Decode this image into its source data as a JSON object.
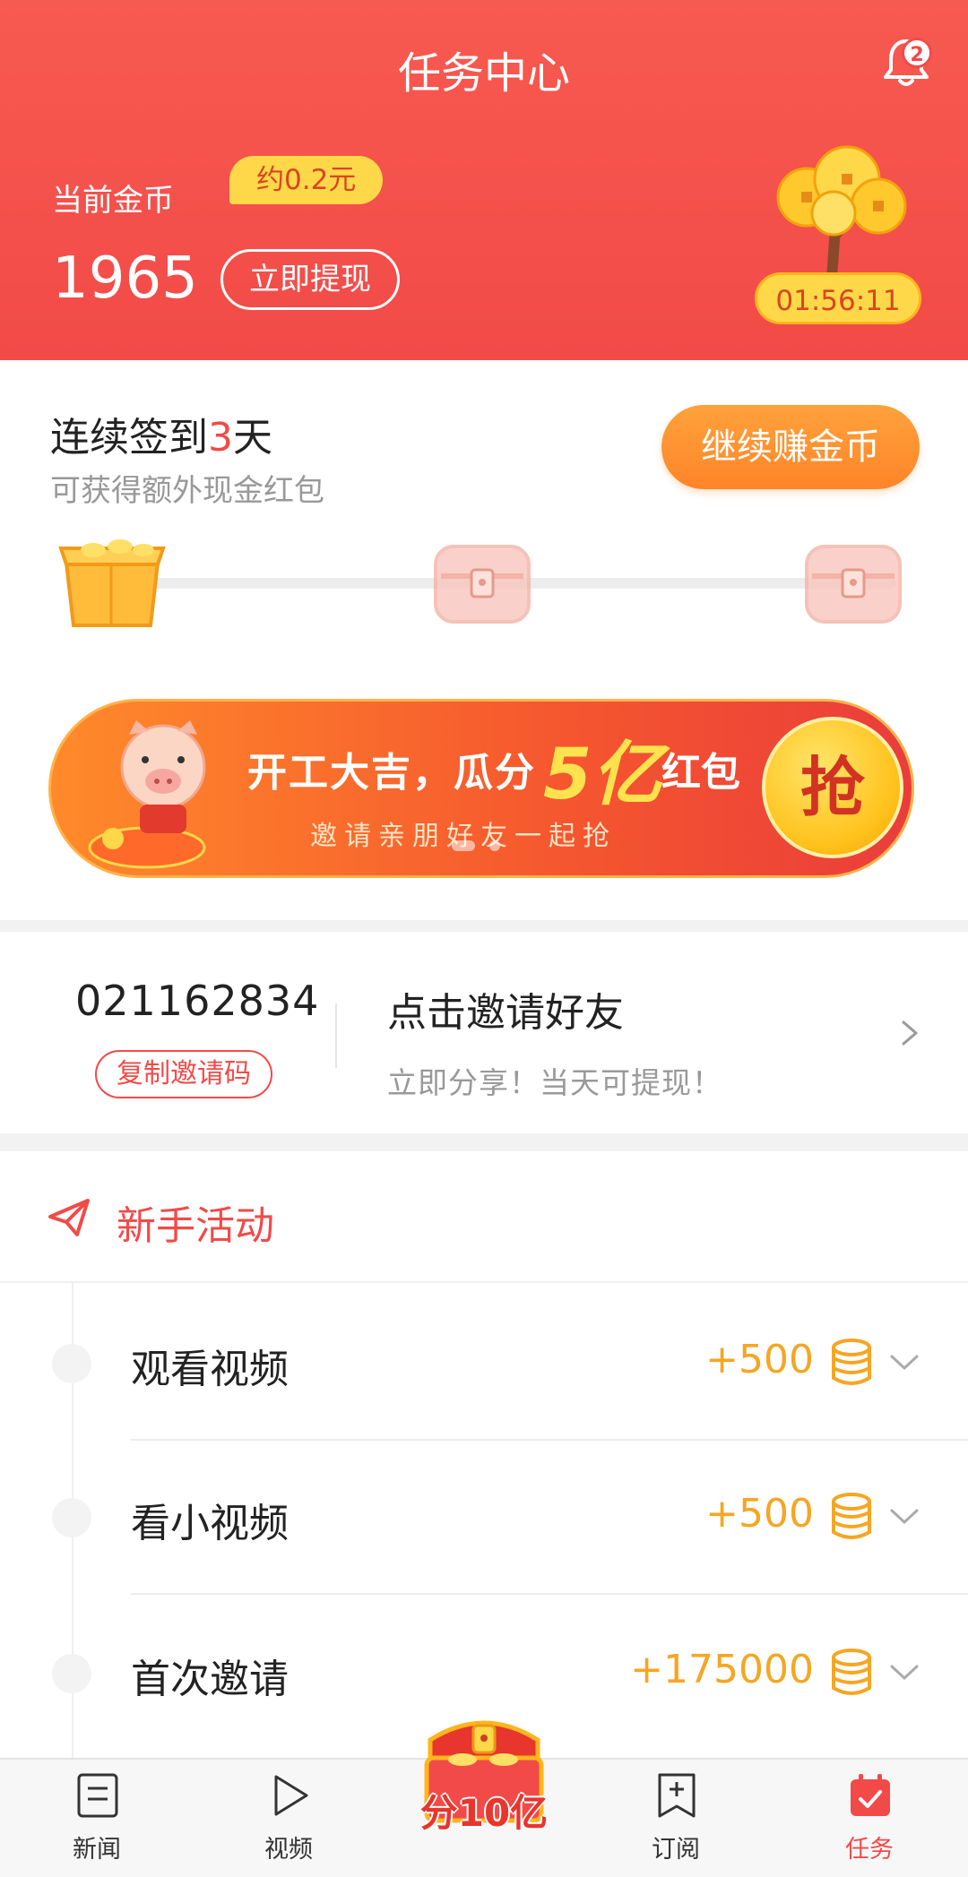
{
  "header": {
    "title": "任务中心",
    "notification_count": "2",
    "coins_label": "当前金币",
    "approx_value": "约0.2元",
    "coins_value": "1965",
    "withdraw_label": "立即提现",
    "timer": "01:56:11"
  },
  "signin": {
    "title_prefix": "连续签到",
    "days": "3",
    "title_suffix": "天",
    "subtitle": "可获得额外现金红包",
    "earn_button": "继续赚金币"
  },
  "banner": {
    "title": "开工大吉，瓜分",
    "highlight": "5亿",
    "title_suffix": "红包",
    "subtitle": "邀请亲朋好友一起抢",
    "grab_button": "抢"
  },
  "invite": {
    "code": "021162834",
    "copy_button": "复制邀请码",
    "title": "点击邀请好友",
    "subtitle": "立即分享！当天可提现！"
  },
  "activities": {
    "heading": "新手活动",
    "items": [
      {
        "label": "观看视频",
        "reward": "+500"
      },
      {
        "label": "看小视频",
        "reward": "+500"
      },
      {
        "label": "首次邀请",
        "reward": "+175000"
      }
    ]
  },
  "nav": {
    "items": [
      {
        "label": "新闻",
        "icon": "news-icon"
      },
      {
        "label": "视频",
        "icon": "video-icon"
      },
      {
        "label": "订阅",
        "icon": "subscribe-icon"
      },
      {
        "label": "任务",
        "icon": "task-icon"
      }
    ],
    "center_label": "分10亿",
    "active": "任务"
  },
  "colors": {
    "brand_red": "#f24a48",
    "accent_orange": "#ff8a2a",
    "coin_gold": "#f5a623",
    "badge_yellow": "#ffd84a"
  }
}
